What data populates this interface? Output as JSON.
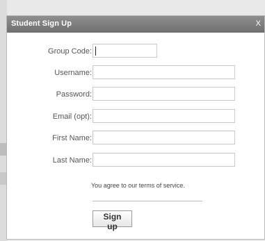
{
  "dialog": {
    "title": "Student Sign Up",
    "close_label": "X"
  },
  "form": {
    "fields": [
      {
        "label": "Group Code:",
        "value": "",
        "placeholder": ""
      },
      {
        "label": "Username:",
        "value": "",
        "placeholder": ""
      },
      {
        "label": "Password:",
        "value": "",
        "placeholder": ""
      },
      {
        "label": "Email (opt):",
        "value": "",
        "placeholder": ""
      },
      {
        "label": "First Name:",
        "value": "",
        "placeholder": ""
      },
      {
        "label": "Last Name:",
        "value": "",
        "placeholder": ""
      }
    ],
    "terms_text": "You agree to our terms of service.",
    "submit_label": "Sign up"
  },
  "colors": {
    "titlebar": "#7f7f7f",
    "title_text": "#ffffff",
    "label_text": "#555555",
    "input_border": "#c8c8c8"
  }
}
